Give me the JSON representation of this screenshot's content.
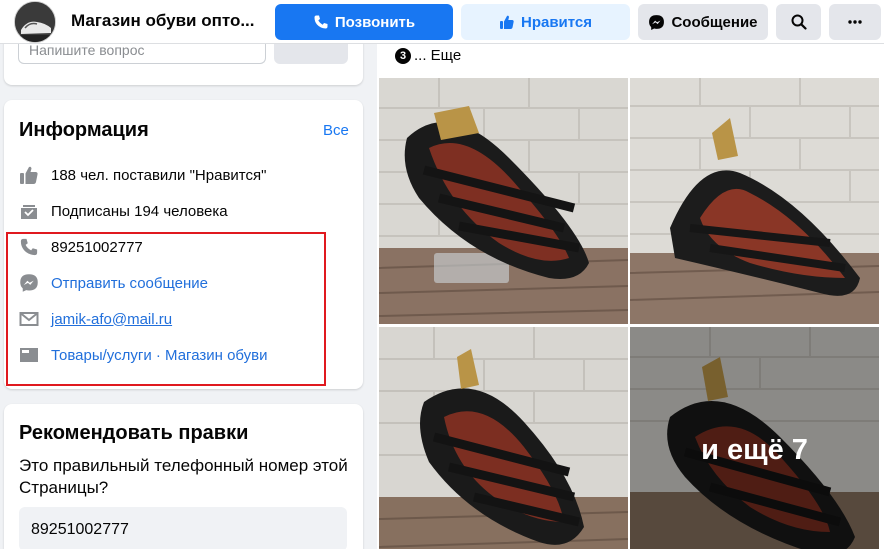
{
  "header": {
    "title": "Магазин обуви опто...",
    "call_label": "Позвонить",
    "like_label": "Нравится",
    "message_label": "Сообщение",
    "accent": "#1877f2"
  },
  "question": {
    "placeholder": "Напишите вопрос"
  },
  "info": {
    "title": "Информация",
    "see_all": "Все",
    "likes": "188 чел. поставили \"Нравится\"",
    "followers": "Подписаны 194 человека",
    "phone": "89251002777",
    "send_message": "Отправить сообщение",
    "email": "jamik-afo@mail.ru",
    "category_1": "Товары/услуги",
    "separator": " · ",
    "category_2": "Магазин обуви",
    "highlight_color": "#e0191f"
  },
  "recommend": {
    "title": "Рекомендовать правки",
    "question": "Это правильный телефонный номер этой Страницы?",
    "phone_value": "89251002777"
  },
  "photos": {
    "caption_prefix": "3",
    "caption": "... Еще",
    "more_label": "и ещё 7",
    "items": [
      "sandal-photo",
      "sandal-photo",
      "sandal-photo",
      "sandal-photo"
    ]
  }
}
